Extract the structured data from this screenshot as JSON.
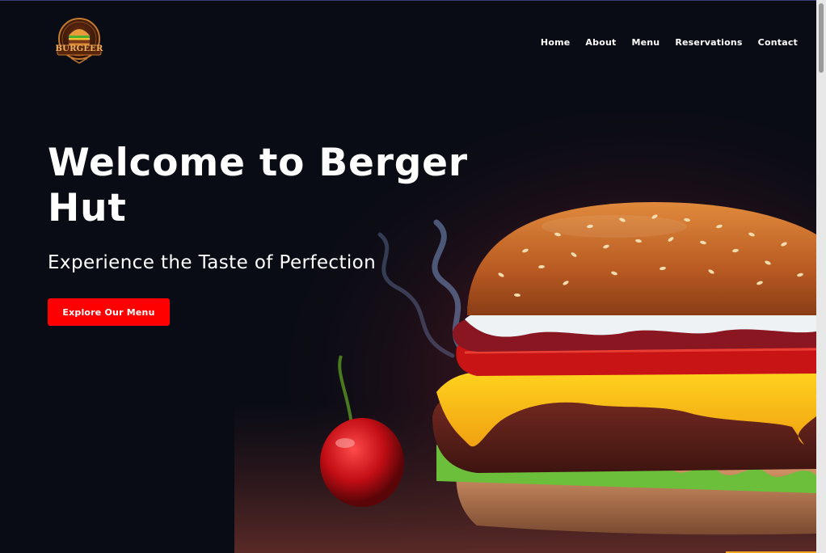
{
  "brand": {
    "logo_text": "BURGEER",
    "logo_icon": "burger-badge-icon"
  },
  "nav": {
    "items": [
      {
        "label": "Home"
      },
      {
        "label": "About"
      },
      {
        "label": "Menu"
      },
      {
        "label": "Reservations"
      },
      {
        "label": "Contact"
      }
    ]
  },
  "hero": {
    "title": "Welcome to Berger Hut",
    "subtitle": "Experience the Taste of Perfection",
    "cta_label": "Explore Our Menu"
  },
  "colors": {
    "background": "#0a0c15",
    "accent_button": "#ff0000",
    "text": "#ffffff"
  }
}
